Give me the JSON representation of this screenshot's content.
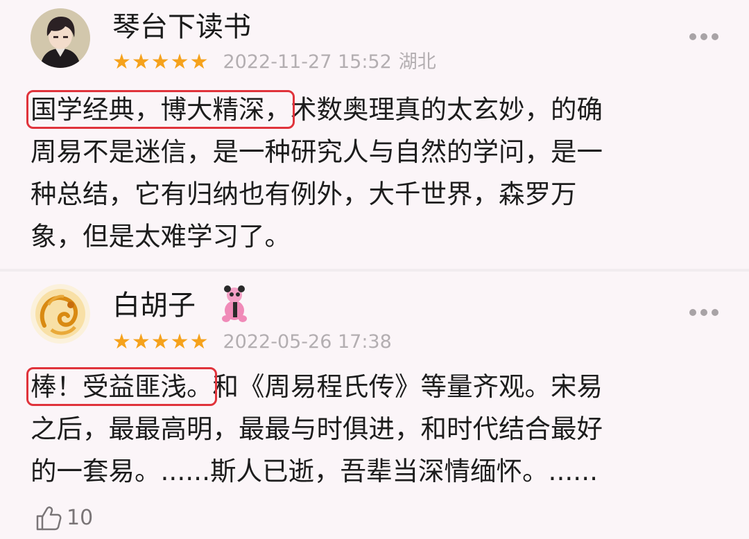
{
  "reviews": [
    {
      "username": "琴台下读书",
      "stars": "★★★★★",
      "date": "2022-11-27 15:52",
      "location": "湖北",
      "lines": [
        {
          "highlight": "国学经典，博大精深，",
          "rest": "术数奥理真的太玄妙，的确"
        },
        {
          "text": "周易不是迷信，是一种研究人与自然的学问，是一"
        },
        {
          "text": "种总结，它有归纳也有例外，大千世界，森罗万"
        },
        {
          "text": "象，但是太难学习了。"
        }
      ]
    },
    {
      "username": "白胡子",
      "stars": "★★★★★",
      "date": "2022-05-26 17:38",
      "lines": [
        {
          "highlight": "棒！受益匪浅。",
          "rest": "和《周易程氏传》等量齐观。宋易"
        },
        {
          "text": "之后，最最高明，最最与时俱进，和时代结合最好"
        },
        {
          "text": "的一套易。......斯人已逝，吾辈当深情缅怀。......"
        }
      ],
      "likes": "10"
    }
  ],
  "icons": {
    "more": "more-dots-icon",
    "like": "thumbs-up-icon",
    "badge": "panda-badge-icon",
    "star": "star-icon"
  },
  "colors": {
    "star": "#f5a21c",
    "highlight_box": "#e0333b",
    "meta_text": "#b3aeb1",
    "background": "#fbf5f8"
  }
}
